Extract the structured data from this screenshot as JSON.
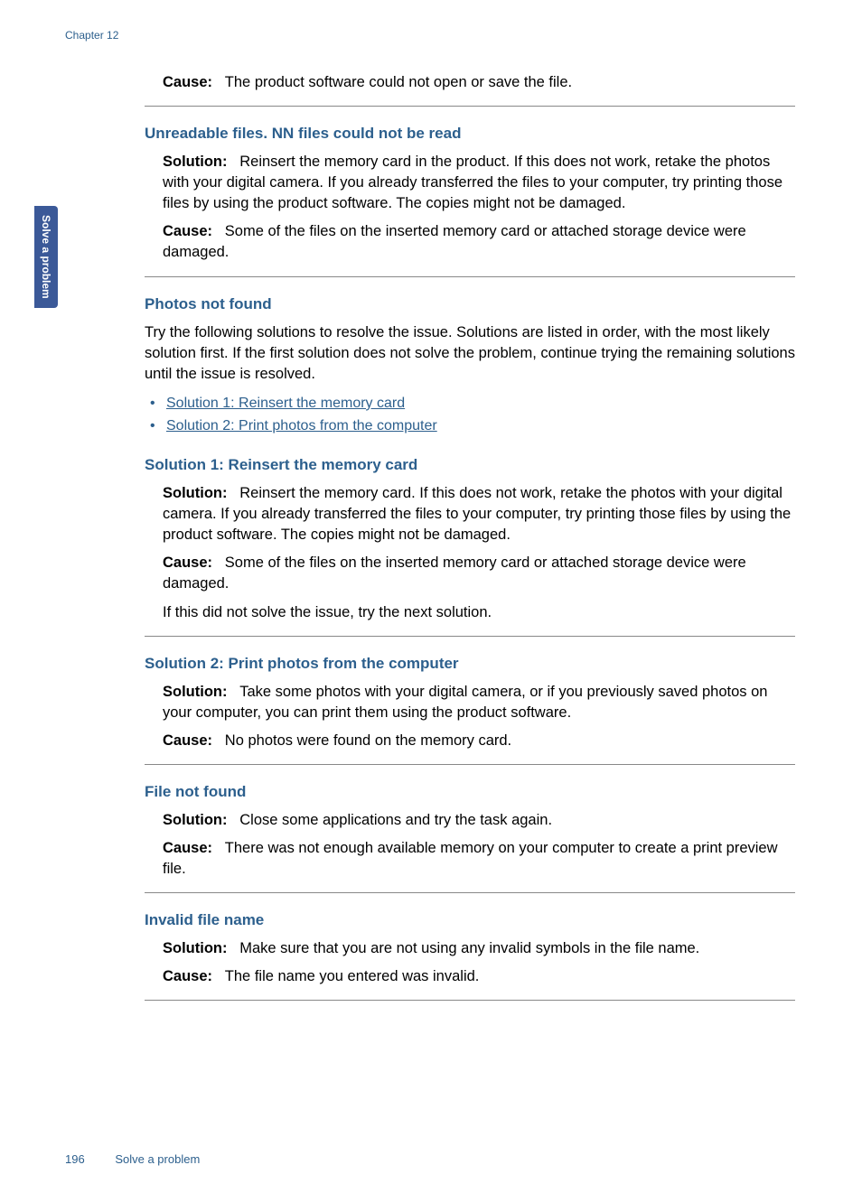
{
  "chapter_label": "Chapter 12",
  "side_tab": "Solve a problem",
  "intro_cause_label": "Cause:",
  "intro_cause_text": "The product software could not open or save the file.",
  "sections": {
    "unreadable": {
      "heading": "Unreadable files. NN files could not be read",
      "solution_label": "Solution:",
      "solution_text": "Reinsert the memory card in the product. If this does not work, retake the photos with your digital camera. If you already transferred the files to your computer, try printing those files by using the product software. The copies might not be damaged.",
      "cause_label": "Cause:",
      "cause_text": "Some of the files on the inserted memory card or attached storage device were damaged."
    },
    "photos_not_found": {
      "heading": "Photos not found",
      "intro": "Try the following solutions to resolve the issue. Solutions are listed in order, with the most likely solution first. If the first solution does not solve the problem, continue trying the remaining solutions until the issue is resolved.",
      "links": [
        "Solution 1: Reinsert the memory card",
        "Solution 2: Print photos from the computer"
      ]
    },
    "sol1": {
      "heading": "Solution 1: Reinsert the memory card",
      "solution_label": "Solution:",
      "solution_text": "Reinsert the memory card. If this does not work, retake the photos with your digital camera. If you already transferred the files to your computer, try printing those files by using the product software. The copies might not be damaged.",
      "cause_label": "Cause:",
      "cause_text": "Some of the files on the inserted memory card or attached storage device were damaged.",
      "next": "If this did not solve the issue, try the next solution."
    },
    "sol2": {
      "heading": "Solution 2: Print photos from the computer",
      "solution_label": "Solution:",
      "solution_text": "Take some photos with your digital camera, or if you previously saved photos on your computer, you can print them using the product software.",
      "cause_label": "Cause:",
      "cause_text": "No photos were found on the memory card."
    },
    "file_not_found": {
      "heading": "File not found",
      "solution_label": "Solution:",
      "solution_text": "Close some applications and try the task again.",
      "cause_label": "Cause:",
      "cause_text": "There was not enough available memory on your computer to create a print preview file."
    },
    "invalid_file_name": {
      "heading": "Invalid file name",
      "solution_label": "Solution:",
      "solution_text": "Make sure that you are not using any invalid symbols in the file name.",
      "cause_label": "Cause:",
      "cause_text": "The file name you entered was invalid."
    }
  },
  "footer": {
    "page_num": "196",
    "section": "Solve a problem"
  }
}
